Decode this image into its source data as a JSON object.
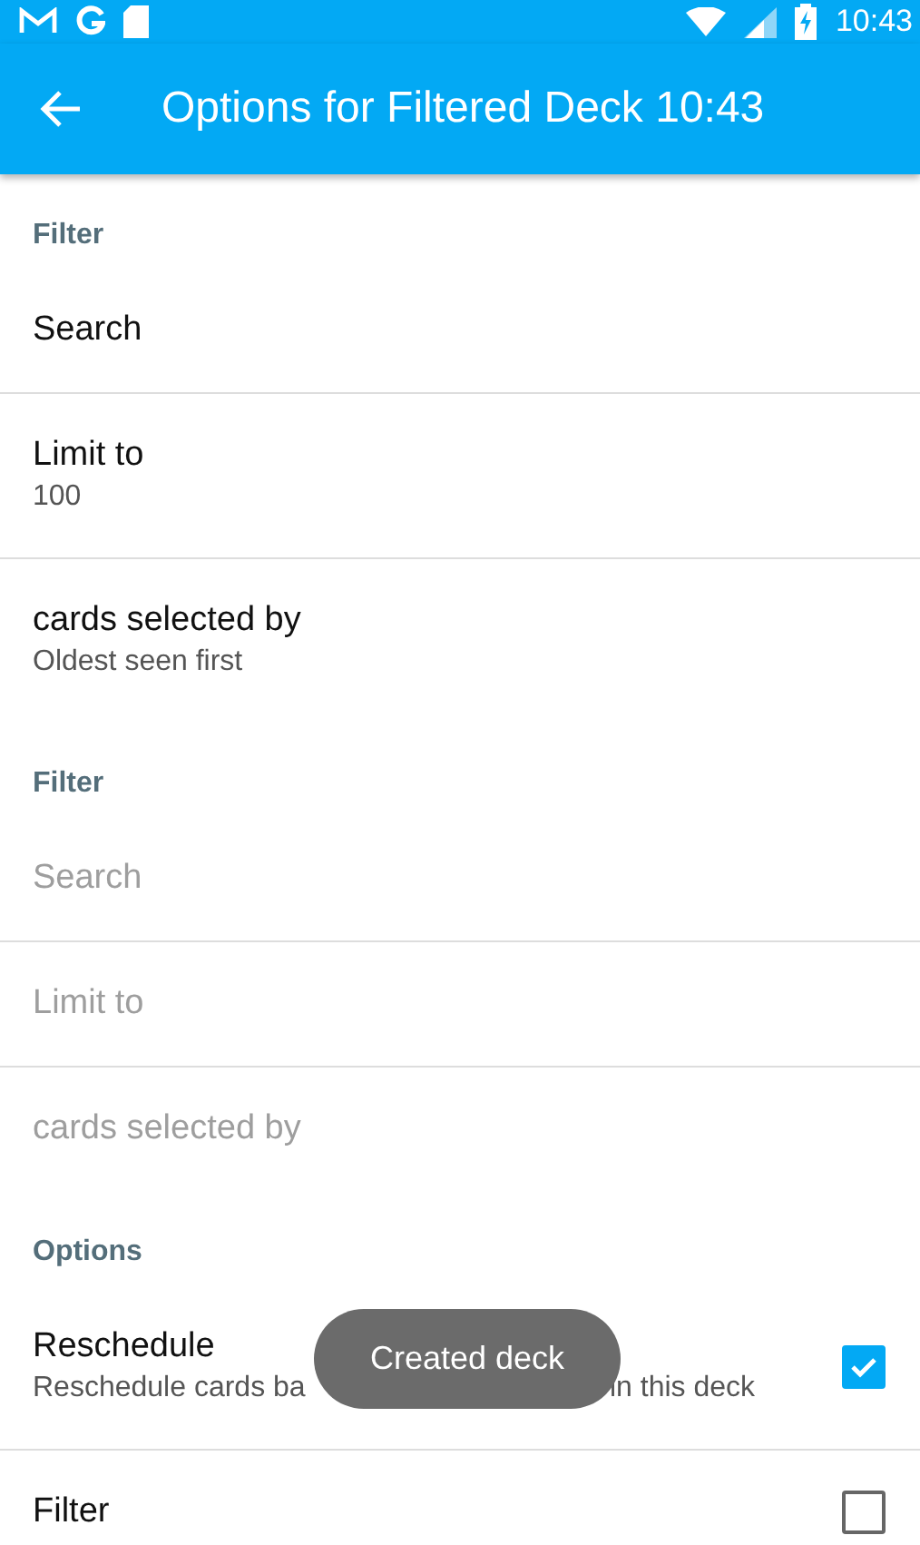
{
  "status_bar": {
    "time": "10:43"
  },
  "app_bar": {
    "title": "Options for Filtered Deck 10:43"
  },
  "items": [
    {
      "kind": "category",
      "title": "Filter"
    },
    {
      "kind": "preference",
      "title": "Search",
      "disabled": false
    },
    {
      "kind": "preference",
      "title": "Limit to",
      "summary": "100",
      "disabled": false
    },
    {
      "kind": "preference",
      "title": "cards selected by",
      "summary": "Oldest seen first",
      "disabled": false
    },
    {
      "kind": "category",
      "title": "Filter"
    },
    {
      "kind": "preference",
      "title": "Search",
      "disabled": true
    },
    {
      "kind": "preference",
      "title": "Limit to",
      "disabled": true
    },
    {
      "kind": "preference",
      "title": "cards selected by",
      "disabled": true
    },
    {
      "kind": "category",
      "title": "Options"
    },
    {
      "kind": "checkbox",
      "title": "Reschedule",
      "summary_parts": [
        "Reschedule cards ba",
        "in this deck"
      ],
      "checked": true,
      "disabled": false
    },
    {
      "kind": "checkbox",
      "title": "Filter",
      "checked": false,
      "disabled": false
    }
  ],
  "toast": {
    "text": "Created deck"
  }
}
